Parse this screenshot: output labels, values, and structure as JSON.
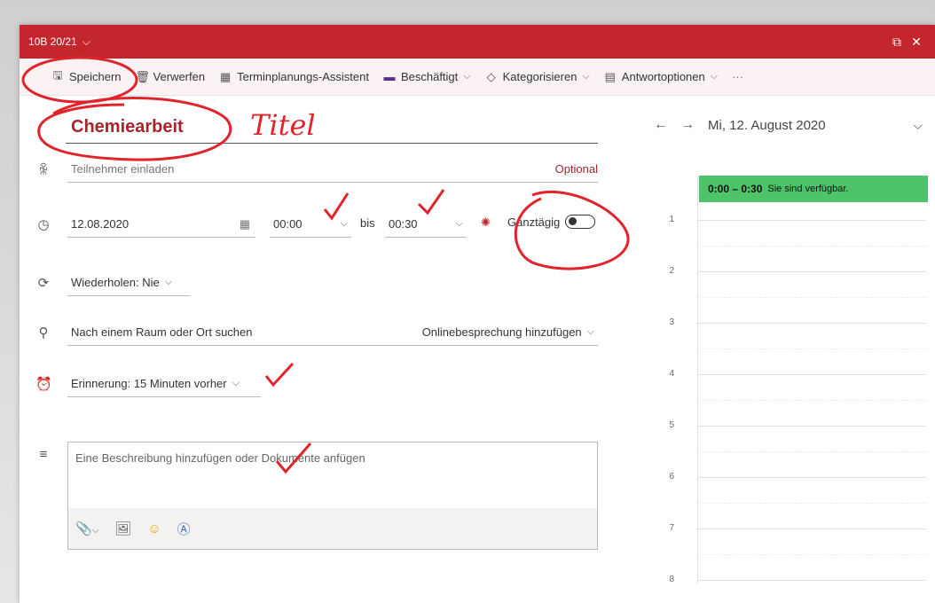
{
  "titlebar": {
    "calendar": "10B 20/21",
    "chevron_icon": "chevron-down-icon",
    "popout_icon": "popout-icon",
    "close_icon": "close-icon",
    "color": "#c4262e"
  },
  "toolbar": {
    "save": "Speichern",
    "discard": "Verwerfen",
    "scheduling": "Terminplanungs-Assistent",
    "busy": "Beschäftigt",
    "categorize": "Kategorisieren",
    "response": "Antwortoptionen",
    "more": "···"
  },
  "form": {
    "title": "Chemiearbeit",
    "attendees_placeholder": "Teilnehmer einladen",
    "optional": "Optional",
    "date": "12.08.2020",
    "start_time": "00:00",
    "bis": "bis",
    "end_time": "00:30",
    "all_day": "Ganztägig",
    "all_day_on": false,
    "repeat": "Wiederholen: Nie",
    "location_placeholder": "Nach einem Raum oder Ort suchen",
    "online_meeting": "Onlinebesprechung hinzufügen",
    "reminder": "Erinnerung: 15 Minuten vorher",
    "description_placeholder": "Eine Beschreibung hinzufügen oder Dokumente anfügen"
  },
  "calendar": {
    "date": "Mi, 12. August 2020",
    "event_time": "0:00 – 0:30",
    "event_text": "Sie sind verfügbar.",
    "event_color": "#4fc36a",
    "hours": [
      "1",
      "2",
      "3",
      "4",
      "5",
      "6",
      "7",
      "8"
    ]
  },
  "annotations": {
    "title_note": "Titel",
    "color": "#e0242b"
  }
}
